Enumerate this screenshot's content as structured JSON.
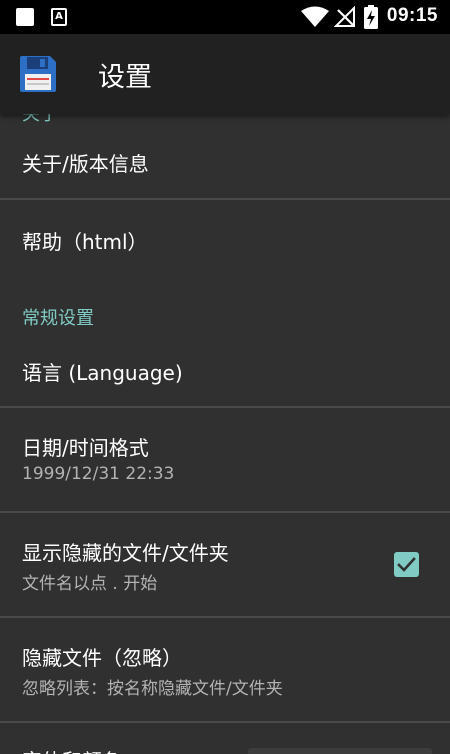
{
  "status_bar": {
    "time": "09:15",
    "notification_icon": "A",
    "icons": [
      "square-notification-icon",
      "a-notification-icon",
      "wifi-icon",
      "no-signal-icon",
      "battery-charging-icon"
    ]
  },
  "app_bar": {
    "title": "设置",
    "logo": "floppy-disk-icon"
  },
  "settings": {
    "cut_header": "关于",
    "about": {
      "title": "关于/版本信息"
    },
    "help": {
      "title": "帮助（html）"
    },
    "general_header": "常规设置",
    "language": {
      "title": "语言 (Language)"
    },
    "datetime": {
      "title": "日期/时间格式",
      "summary": "1999/12/31  22:33"
    },
    "show_hidden": {
      "title": "显示隐藏的文件/文件夹",
      "summary": "文件名以点 . 开始",
      "checked": true
    },
    "hide_files": {
      "title": "隐藏文件（忽略）",
      "summary": "忽略列表：按名称隐藏文件/文件夹"
    },
    "next_item": {
      "title": "字体和颜色"
    }
  },
  "colors": {
    "accent": "#80cbc4",
    "background": "#303030",
    "app_bar": "#212121",
    "divider": "#4a4a4a"
  }
}
